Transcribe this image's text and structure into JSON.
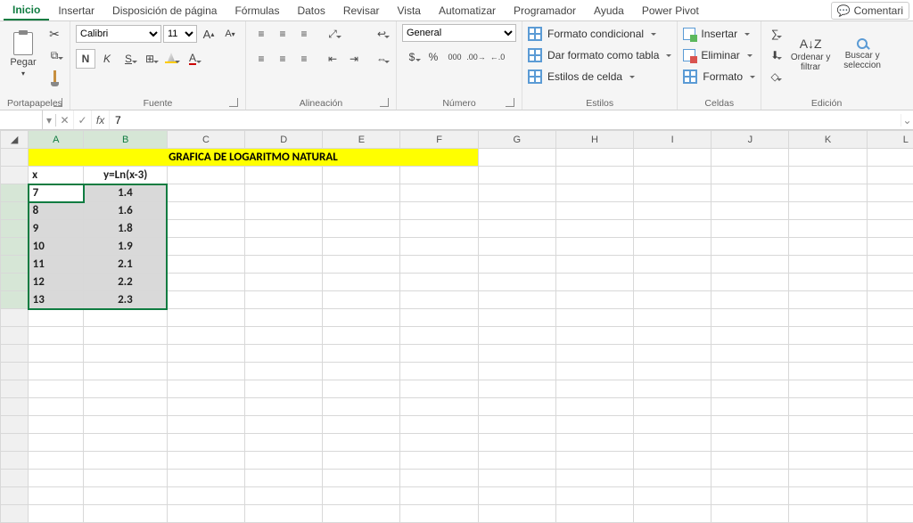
{
  "tabs": {
    "items": [
      "Inicio",
      "Insertar",
      "Disposición de página",
      "Fórmulas",
      "Datos",
      "Revisar",
      "Vista",
      "Automatizar",
      "Programador",
      "Ayuda",
      "Power Pivot"
    ],
    "active": "Inicio",
    "comments": "Comentari"
  },
  "ribbon": {
    "clipboard": {
      "label": "Portapapeles",
      "paste": "Pegar"
    },
    "font": {
      "label": "Fuente",
      "name": "Calibri",
      "size": "11",
      "bold": "N",
      "italic": "K",
      "underline": "S"
    },
    "alignment": {
      "label": "Alineación"
    },
    "number": {
      "label": "Número",
      "format": "General"
    },
    "styles": {
      "label": "Estilos",
      "cond": "Formato condicional",
      "table": "Dar formato como tabla",
      "cell": "Estilos de celda"
    },
    "cells": {
      "label": "Celdas",
      "insert": "Insertar",
      "delete": "Eliminar",
      "format": "Formato"
    },
    "editing": {
      "label": "Edición",
      "sort": "Ordenar y filtrar",
      "find": "Buscar y seleccion"
    }
  },
  "formula_bar": {
    "name_box": "",
    "formula": "7"
  },
  "sheet": {
    "columns": [
      "A",
      "B",
      "C",
      "D",
      "E",
      "F",
      "G",
      "H",
      "I",
      "J",
      "K",
      "L"
    ],
    "title": "GRAFICA DE LOGARITMO NATURAL",
    "headers": {
      "x": "x",
      "y": "y=Ln(x-3)"
    },
    "rows": [
      {
        "x": "7",
        "y": "1.4"
      },
      {
        "x": "8",
        "y": "1.6"
      },
      {
        "x": "9",
        "y": "1.8"
      },
      {
        "x": "10",
        "y": "1.9"
      },
      {
        "x": "11",
        "y": "2.1"
      },
      {
        "x": "12",
        "y": "2.2"
      },
      {
        "x": "13",
        "y": "2.3"
      }
    ]
  },
  "chart_data": {
    "type": "line",
    "title": "GRAFICA DE LOGARITMO NATURAL",
    "xlabel": "x",
    "ylabel": "y=Ln(x-3)",
    "x": [
      7,
      8,
      9,
      10,
      11,
      12,
      13
    ],
    "series": [
      {
        "name": "y=Ln(x-3)",
        "values": [
          1.4,
          1.6,
          1.8,
          1.9,
          2.1,
          2.2,
          2.3
        ]
      }
    ]
  }
}
